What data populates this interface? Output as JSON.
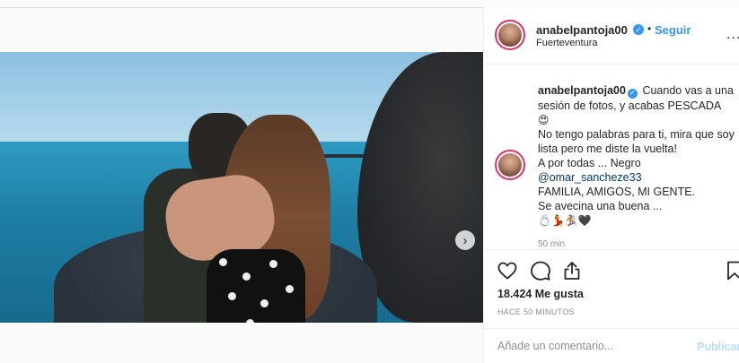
{
  "post": {
    "username": "anabelpantoja00",
    "follow_label": "Seguir",
    "separator": "•",
    "location": "Fuerteventura",
    "more_label": "...",
    "caption": {
      "username": "anabelpantoja00",
      "line1": "Cuando vas a una sesión de fotos, y acabas PESCADA",
      "line2": "😍",
      "line3": "No tengo palabras para ti, mira que soy lista pero me diste la vuelta!",
      "line4": "A por todas ... Negro",
      "mention": "@omar_sancheze33",
      "line5": "FAMILIA, AMIGOS, MI GENTE.",
      "line6": "Se avecina una buena ...",
      "emojis": "💍💃🏂🖤"
    },
    "caption_time": "50 min",
    "likes": "18.424 Me gusta",
    "time_ago": "HACE 50 MINUTOS"
  },
  "comment": {
    "placeholder": "Añade un comentario...",
    "publish_label": "Publicar"
  },
  "media": {
    "next_arrow": "›",
    "carousel_total": 3,
    "carousel_active": 1
  },
  "colors": {
    "accent": "#3897f0",
    "publish_disabled": "#b2dffc",
    "story_ring": "#e1306c"
  }
}
